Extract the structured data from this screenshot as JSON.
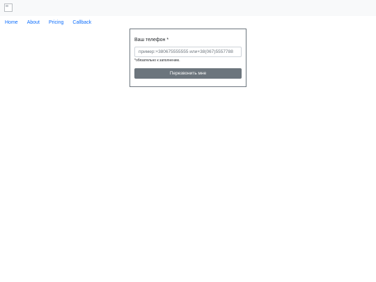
{
  "nav": {
    "items": [
      {
        "label": "Home"
      },
      {
        "label": "About"
      },
      {
        "label": "Pricing"
      },
      {
        "label": "Callback"
      }
    ]
  },
  "form": {
    "phone_label": "Ваш телефон *",
    "phone_value": "",
    "phone_placeholder": "пример:+380675555555 или+38(067)5557788",
    "help_text": "*обязательно к заполнению.",
    "submit_label": "Перезвонить мне"
  },
  "colors": {
    "topbar_bg": "#f8f9fa",
    "link": "#0d6efd",
    "button_bg": "#6c757d",
    "card_border": "#6c757d"
  }
}
